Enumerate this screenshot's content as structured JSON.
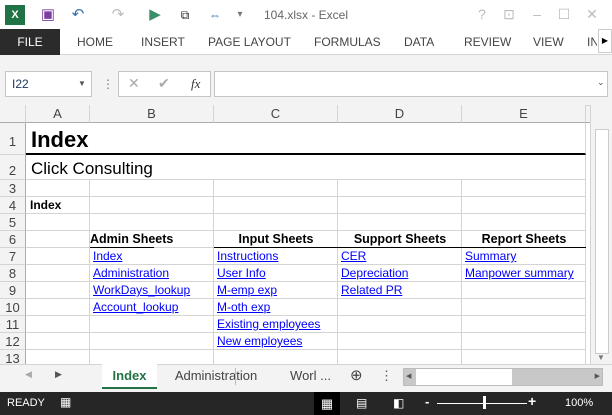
{
  "window": {
    "title": "104.xlsx - Excel"
  },
  "ribbon": {
    "tabs": [
      "FILE",
      "HOME",
      "INSERT",
      "PAGE LAYOUT",
      "FORMULAS",
      "DATA",
      "REVIEW",
      "VIEW",
      "IN"
    ]
  },
  "formula_bar": {
    "name_box": "I22",
    "formula": "",
    "fx": "fx"
  },
  "columns": [
    "A",
    "B",
    "C",
    "D",
    "E"
  ],
  "rows": [
    "1",
    "2",
    "3",
    "4",
    "5",
    "6",
    "7",
    "8",
    "9",
    "10",
    "11",
    "12",
    "13"
  ],
  "cells": {
    "A1": "Index",
    "A2": "Click Consulting",
    "A4": "Index",
    "B6": "Admin Sheets",
    "C6": "Input Sheets",
    "D6": "Support Sheets",
    "E6": "Report Sheets",
    "B": [
      "Index",
      "Administration",
      "WorkDays_lookup",
      "Account_lookup"
    ],
    "C": [
      "Instructions",
      "User Info",
      "M-emp exp",
      "M-oth exp",
      "Existing employees",
      "New employees"
    ],
    "D": [
      "CER",
      "Depreciation",
      "Related PR"
    ],
    "E": [
      "Summary",
      "Manpower summary"
    ]
  },
  "sheet_tabs": [
    "Index",
    "Administration",
    "Worl ..."
  ],
  "status": {
    "ready": "READY",
    "zoom": "100%"
  },
  "colors": {
    "accent": "#217346",
    "link": "#0000ff"
  }
}
